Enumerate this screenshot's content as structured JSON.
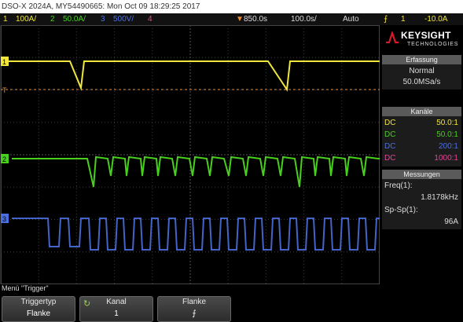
{
  "title": "DSO-X 2024A, MY54490665: Mon Oct 09 18:29:25 2017",
  "channels": [
    {
      "num": "1",
      "scale": "100A/",
      "color": "#f0e63c"
    },
    {
      "num": "2",
      "scale": "50.0A/",
      "color": "#47d11d"
    },
    {
      "num": "3",
      "scale": "500V/",
      "color": "#4b6fe0"
    },
    {
      "num": "4",
      "scale": "",
      "color": "#e04696"
    }
  ],
  "timebase": {
    "position": "850.0s",
    "scale": "100.0s/",
    "trigger_mode": "Auto",
    "trigger_source": "1",
    "trigger_level": "-10.0A"
  },
  "logo": {
    "name": "KEYSIGHT",
    "sub": "TECHNOLOGIES"
  },
  "acquisition": {
    "header": "Erfassung",
    "mode": "Normal",
    "rate": "50.0MSa/s"
  },
  "channels_panel": {
    "header": "Kanäle",
    "rows": [
      {
        "coupling": "DC",
        "ratio": "50.0:1",
        "color": "#f0e63c"
      },
      {
        "coupling": "DC",
        "ratio": "50.0:1",
        "color": "#47d11d"
      },
      {
        "coupling": "DC",
        "ratio": "200:1",
        "color": "#4b6fe0"
      },
      {
        "coupling": "DC",
        "ratio": "1000:1",
        "color": "#e04696"
      }
    ]
  },
  "measurements": {
    "header": "Messungen",
    "freq_label": "Freq(1):",
    "freq_value": "1.8178kHz",
    "pp_label": "Sp-Sp(1):",
    "pp_value": "96A"
  },
  "menu": {
    "title": "Menü \"Trigger\"",
    "softkeys": [
      {
        "label": "Triggertyp",
        "value": "Flanke"
      },
      {
        "label": "Kanal",
        "value": "1",
        "icon": "rotate-knob-icon"
      },
      {
        "label": "Flanke",
        "value": "rising-edge-icon"
      }
    ]
  },
  "markers": {
    "ch1": "1",
    "ch2": "2",
    "ch3": "3",
    "trigger_level": "T"
  }
}
